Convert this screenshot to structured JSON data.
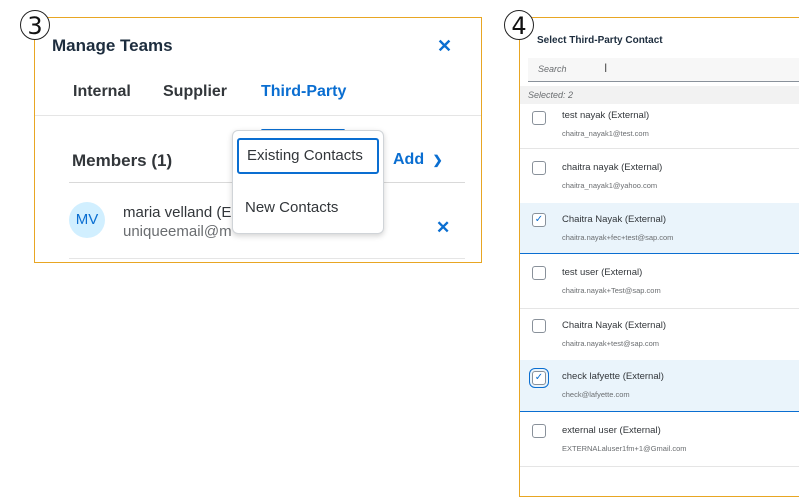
{
  "step_labels": [
    "3",
    "4"
  ],
  "manage_teams": {
    "title": "Manage Teams",
    "tabs": [
      {
        "label": "Internal",
        "active": false
      },
      {
        "label": "Supplier",
        "active": false
      },
      {
        "label": "Third-Party",
        "active": true
      }
    ],
    "members_label": "Members (1)",
    "add_label": "Add",
    "add_dropdown": [
      "Existing Contacts",
      "New Contacts"
    ],
    "member": {
      "initials": "MV",
      "name": "maria velland (E",
      "email": "uniqueemail@m"
    }
  },
  "select_contact": {
    "title": "Select Third-Party Contact",
    "search_placeholder": "Search",
    "selected_text": "Selected: 2",
    "contacts": [
      {
        "name": "test nayak (External)",
        "email": "chaitra_nayak1@test.com",
        "checked": false
      },
      {
        "name": "chaitra nayak (External)",
        "email": "chaitra_nayak1@yahoo.com",
        "checked": false
      },
      {
        "name": "Chaitra Nayak (External)",
        "email": "chaitra.nayak+fec+test@sap.com",
        "checked": true
      },
      {
        "name": "test user (External)",
        "email": "chaitra.nayak+Test@sap.com",
        "checked": false
      },
      {
        "name": "Chaitra Nayak (External)",
        "email": "chaitra.nayak+test@sap.com",
        "checked": false
      },
      {
        "name": "check lafyette (External)",
        "email": "check@lafyette.com",
        "checked": true
      },
      {
        "name": "external user (External)",
        "email": "EXTERNALaluser1fm+1@Gmail.com",
        "checked": false
      }
    ]
  },
  "colors": {
    "accent": "#0a6ed1",
    "highlight_border": "#e8a623",
    "selected_row_bg": "#eaf4fb"
  }
}
